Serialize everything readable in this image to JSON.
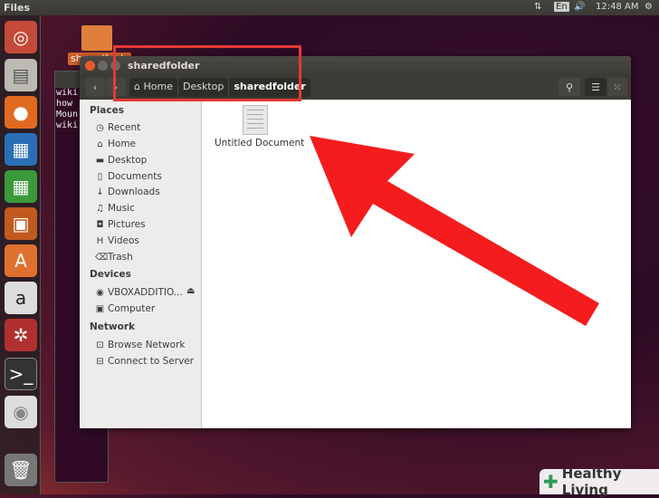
{
  "topbar": {
    "app": "Files",
    "lang": "En",
    "time": "12:48 AM"
  },
  "desktop": {
    "folder_label": "sharedfolder"
  },
  "terminal": {
    "lines": "wiki\nhow\nMoun\nwiki"
  },
  "window": {
    "title": "sharedfolder",
    "breadcrumb": [
      "Home",
      "Desktop",
      "sharedfolder"
    ]
  },
  "sidebar": {
    "places_header": "Places",
    "places": [
      {
        "label": "Recent",
        "icon": "clock-icon"
      },
      {
        "label": "Home",
        "icon": "home-icon"
      },
      {
        "label": "Desktop",
        "icon": "folder-icon"
      },
      {
        "label": "Documents",
        "icon": "document-icon"
      },
      {
        "label": "Downloads",
        "icon": "download-icon"
      },
      {
        "label": "Music",
        "icon": "music-icon"
      },
      {
        "label": "Pictures",
        "icon": "camera-icon"
      },
      {
        "label": "Videos",
        "icon": "film-icon"
      },
      {
        "label": "Trash",
        "icon": "trash-icon"
      }
    ],
    "devices_header": "Devices",
    "devices": [
      {
        "label": "VBOXADDITIO..."
      },
      {
        "label": "Computer"
      }
    ],
    "network_header": "Network",
    "network": [
      {
        "label": "Browse Network"
      },
      {
        "label": "Connect to Server"
      }
    ]
  },
  "files": [
    {
      "name": "Untitled Document"
    }
  ],
  "watermark": "Healthy Living",
  "colors": {
    "annotation": "#e53935",
    "accent": "#e95420"
  }
}
